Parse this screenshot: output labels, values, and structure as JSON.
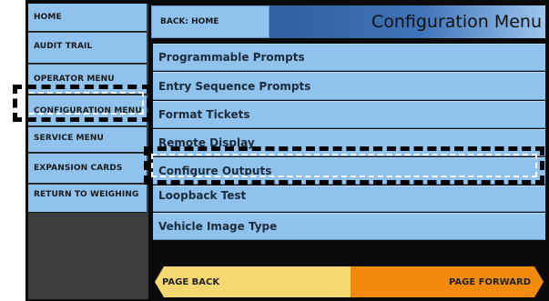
{
  "sidebar": {
    "items": [
      {
        "label": "HOME"
      },
      {
        "label": "AUDIT TRAIL"
      },
      {
        "label": "OPERATOR MENU"
      },
      {
        "label": "CONFIGURATION MENU"
      },
      {
        "label": "SERVICE MENU"
      },
      {
        "label": "EXPANSION CARDS"
      },
      {
        "label": "RETURN TO WEIGHING"
      }
    ]
  },
  "header": {
    "back_label": "BACK: HOME",
    "title": "Configuration Menu"
  },
  "menu": {
    "items": [
      {
        "label": "Programmable Prompts"
      },
      {
        "label": "Entry Sequence Prompts"
      },
      {
        "label": "Format Tickets"
      },
      {
        "label": "Remote Display"
      },
      {
        "label": "Configure Outputs"
      },
      {
        "label": "Loopback Test"
      },
      {
        "label": "Vehicle Image Type"
      }
    ]
  },
  "footer": {
    "page_back": "PAGE BACK",
    "page_forward": "PAGE FORWARD"
  },
  "colors": {
    "button_blue": "#8fc3ee",
    "title_blue": "#2f5f9e",
    "page_back_yellow": "#f5d870",
    "page_forward_orange": "#f28b0c"
  }
}
